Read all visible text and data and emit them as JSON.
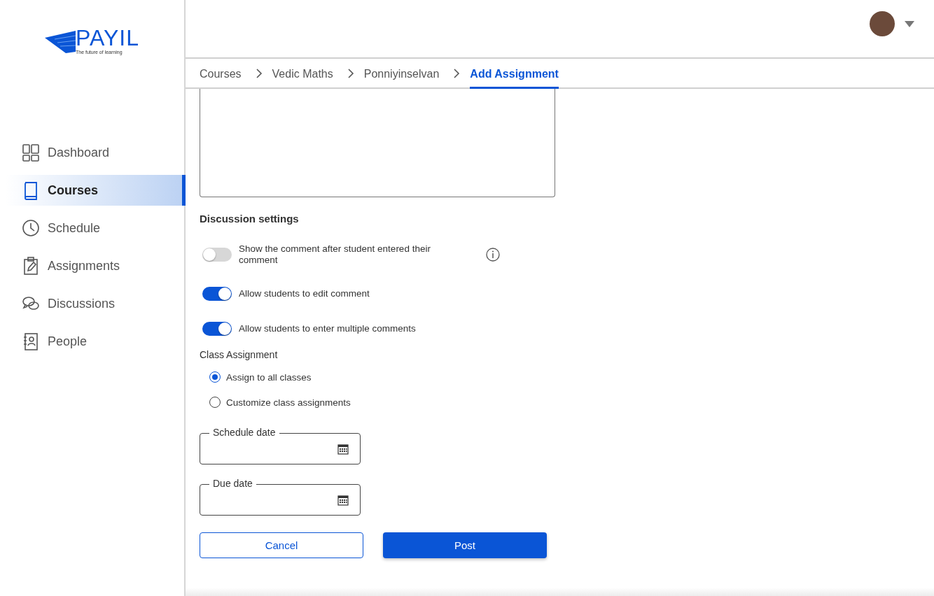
{
  "logo": {
    "name": "PAYIL",
    "tagline": "The future of learning"
  },
  "sidebar": {
    "items": [
      {
        "label": "Dashboard",
        "selected": false
      },
      {
        "label": "Courses",
        "selected": true
      },
      {
        "label": "Schedule",
        "selected": false
      },
      {
        "label": "Assignments",
        "selected": false
      },
      {
        "label": "Discussions",
        "selected": false
      },
      {
        "label": "People",
        "selected": false
      }
    ]
  },
  "breadcrumbs": [
    {
      "label": "Courses",
      "current": false
    },
    {
      "label": "Vedic Maths",
      "current": false
    },
    {
      "label": "Ponniyinselvan",
      "current": false
    },
    {
      "label": "Add Assignment",
      "current": true
    }
  ],
  "discussion_settings": {
    "title": "Discussion settings",
    "toggles": [
      {
        "label": "Show the comment after student entered their comment",
        "on": false,
        "info": true
      },
      {
        "label": "Allow students to edit comment",
        "on": true,
        "info": false
      },
      {
        "label": "Allow students to enter multiple comments",
        "on": true,
        "info": false
      }
    ]
  },
  "class_assignment": {
    "title": "Class Assignment",
    "options": [
      {
        "label": "Assign to all classes",
        "selected": true
      },
      {
        "label": "Customize class assignments",
        "selected": false
      }
    ]
  },
  "date_fields": [
    {
      "label": "Schedule date"
    },
    {
      "label": "Due date"
    }
  ],
  "buttons": [
    {
      "label": "Cancel",
      "kind": "outline"
    },
    {
      "label": "Post",
      "kind": "primary"
    }
  ]
}
